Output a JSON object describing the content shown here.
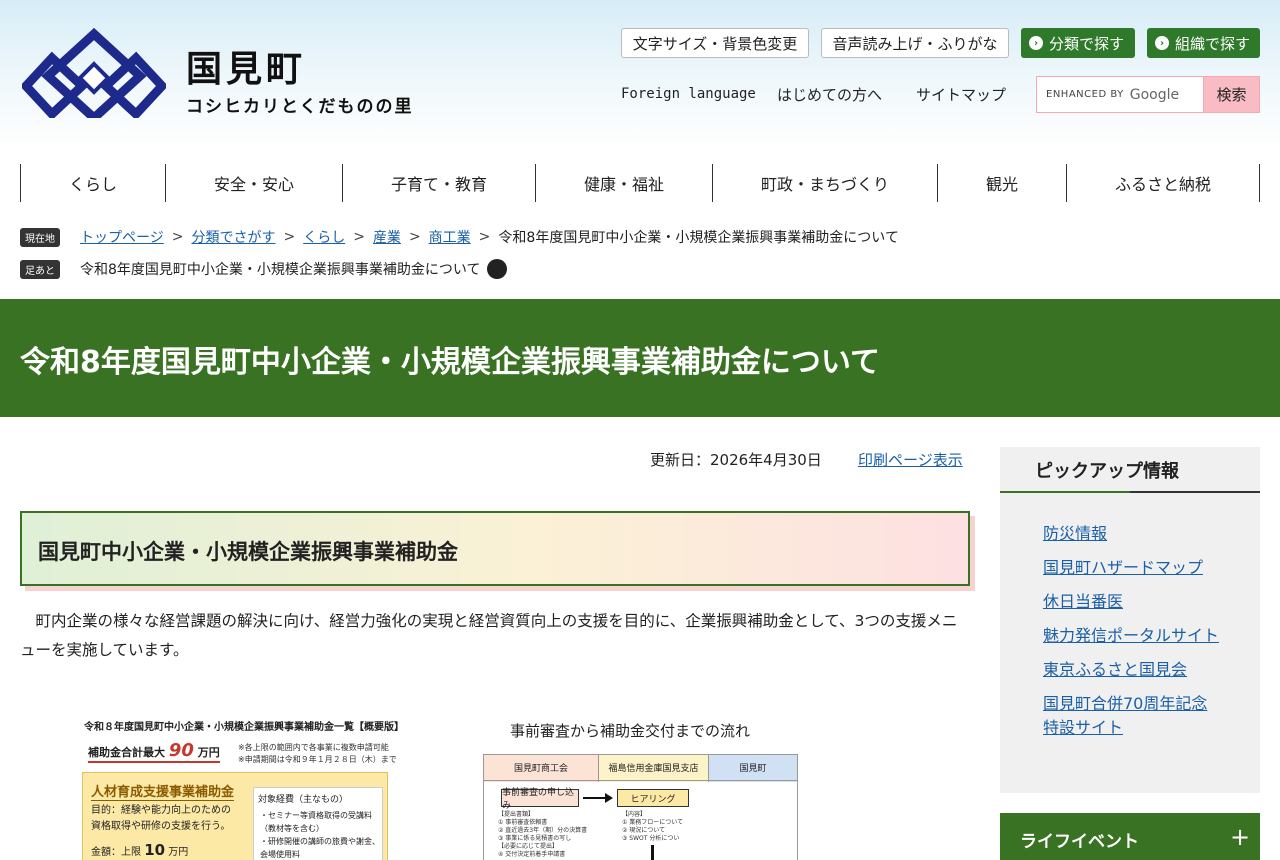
{
  "header": {
    "site_name": "国見町",
    "tagline": "コシヒカリとくだものの里",
    "util_buttons": [
      "文字サイズ・背景色変更",
      "音声読み上げ・ふりがな"
    ],
    "green_buttons": [
      "分類で探す",
      "組織で探す"
    ],
    "links": [
      "Foreign language",
      "はじめての方へ",
      "サイトマップ"
    ],
    "search": {
      "enhanced_by": "ENHANCED BY",
      "google": "Google",
      "button": "検索"
    }
  },
  "nav": [
    "くらし",
    "安全・安心",
    "子育て・教育",
    "健康・福祉",
    "町政・まちづくり",
    "観光",
    "ふるさと納税"
  ],
  "breadcrumb": {
    "current_tag": "現在地",
    "items": [
      "トップページ",
      "分類でさがす",
      "くらし",
      "産業",
      "商工業"
    ],
    "sep": ">",
    "current": "令和8年度国見町中小企業・小規模企業振興事業補助金について",
    "footprint_tag": "足あと",
    "footprint_item": "令和8年度国見町中小企業・小規模企業振興事業補助金について"
  },
  "page": {
    "title": "令和8年度国見町中小企業・小規模企業振興事業補助金について",
    "updated": "更新日：2026年4月30日",
    "print_link": "印刷ページ表示",
    "section_heading": "国見町中小企業・小規模企業振興事業補助金",
    "body": "町内企業の様々な経営課題の解決に向け、経営力強化の実現と経営資質向上の支援を目的に、企業振興補助金として、3つの支援メニューを実施しています。"
  },
  "figure_left": {
    "title": "令和８年度国見町中小企業・小規模企業振興事業補助金一覧【概要版】",
    "max_label": "補助金合計最大",
    "max_value": "90",
    "max_unit": "万円",
    "note1": "※各上限の範囲内で各事業に複数申請可能",
    "note2": "※申請期間は令和９年１月２８日（木）まで",
    "box_heading": "人材育成支援事業補助金",
    "purpose1": "目的：経験や能力向上のための",
    "purpose2": "資格取得や研修の支援を行う。",
    "amount_label": "金額：上限",
    "amount_value": "10",
    "amount_unit": "万円",
    "expense_head": "対象経費（主なもの）",
    "expense1": "・セミナー等資格取得の受講料",
    "expense2": "（教材等を含む）",
    "expense3": "・研修開催の講師の旅費や謝金、",
    "expense4": "会場使用料"
  },
  "figure_right": {
    "title": "事前審査から補助金交付までの流れ",
    "columns": [
      "国見町商工会",
      "福島信用金庫国見支店",
      "国見町"
    ],
    "box1": "事前審査の申し込み",
    "box2": "ヒアリング",
    "notes1": [
      "【提出書類】",
      "① 事前審査依頼書",
      "② 直近過去3年（期）分の決算書",
      "③ 事業に係る見積書の写し",
      "【必要に応じて提出】",
      "④ 交付決定前着手申請書"
    ],
    "notes2": [
      "【内容】",
      "① 業務フローについて",
      "② 現況について",
      "③ SWOT 分析につい"
    ]
  },
  "sidebar": {
    "pickup_title": "ピックアップ情報",
    "pickup_items": [
      "防災情報",
      "国見町ハザードマップ",
      "休日当番医",
      "魅力発信ポータルサイト",
      "東京ふるさと国見会",
      "国見町合併70周年記念特設サイト"
    ],
    "life_event": "ライフイベント",
    "life_event_icon": "plus-icon"
  },
  "colors": {
    "brand_green": "#3a7223",
    "logo_blue": "#1d2a8c",
    "search_pink": "#f9bcc4"
  }
}
